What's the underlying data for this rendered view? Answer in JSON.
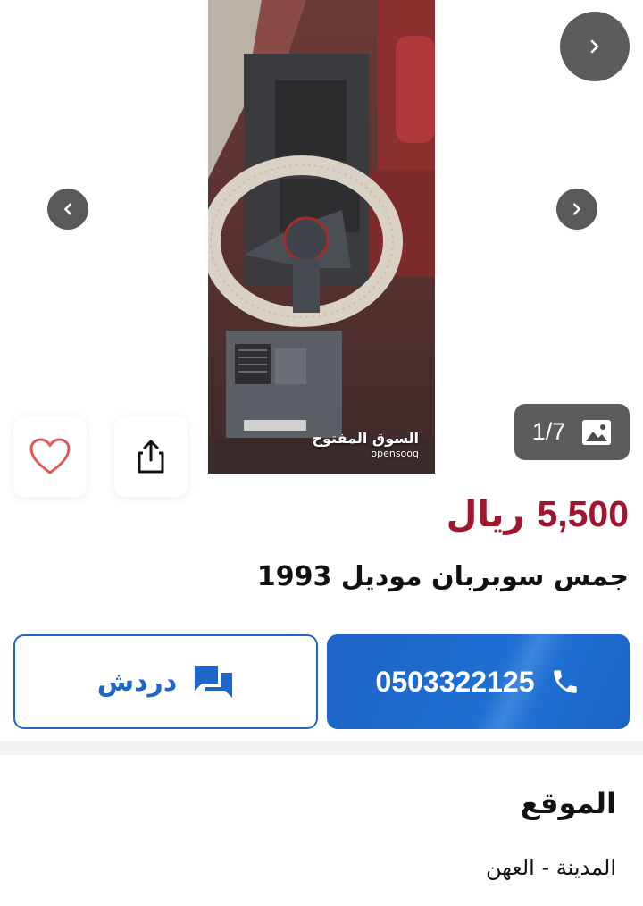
{
  "gallery": {
    "counter": "1/7",
    "watermark_ar": "السوق المفتوح",
    "watermark_en": "opensooq"
  },
  "listing": {
    "price_amount": "5,500",
    "price_currency": "ريال",
    "title": "جمس سوبربان موديل 1993"
  },
  "actions": {
    "call_label": "0503322125",
    "chat_label": "دردش"
  },
  "location": {
    "heading": "الموقع",
    "value": "المدينة - العهن"
  },
  "icons": {
    "next": "chevron-right-icon",
    "prev": "chevron-left-icon",
    "photo": "image-icon",
    "favorite": "heart-icon",
    "share": "share-icon",
    "phone": "phone-icon",
    "chat": "chat-icon"
  },
  "colors": {
    "price": "#a1162e",
    "primary_blue": "#1e66c8",
    "favorite_heart": "#e05a5a"
  }
}
